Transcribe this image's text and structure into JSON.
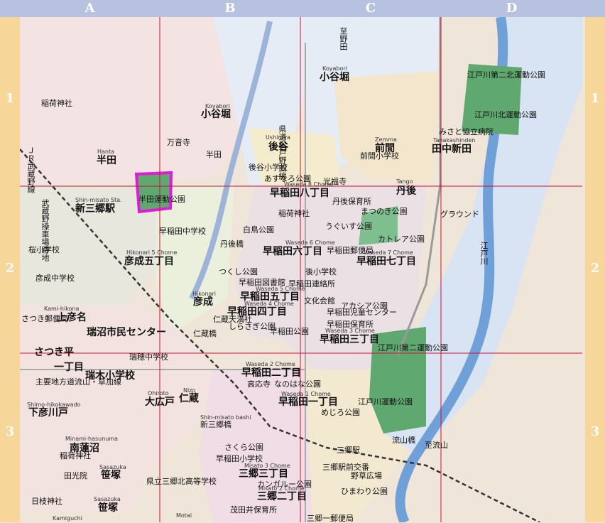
{
  "grid": {
    "columns": [
      "A",
      "B",
      "C",
      "D"
    ],
    "rows": [
      "1",
      "2",
      "3"
    ]
  },
  "colors": {
    "column_header": "#b7c2e1",
    "row_header": "#f7d69a",
    "grid_line": "#d0103a",
    "river": "#6fa0d8",
    "park": "#5fa870",
    "highlight": "#e01bd6",
    "railway": "#333333"
  },
  "labels": [
    {
      "name": "koyabori-north-en",
      "text": "Koyabori"
    },
    {
      "name": "koyabori-north",
      "text": "小谷堀"
    },
    {
      "name": "koyabori-west-en",
      "text": "Koyabori"
    },
    {
      "name": "koyabori-west",
      "text": "小谷堀"
    },
    {
      "name": "road-shinoda-v",
      "text": "至野田"
    },
    {
      "name": "inari-shrine",
      "text": "稲荷神社"
    },
    {
      "name": "manzoji",
      "text": "万音寺"
    },
    {
      "name": "handa-en",
      "text": "Hanta"
    },
    {
      "name": "handa",
      "text": "半田"
    },
    {
      "name": "handa-station",
      "text": "半田"
    },
    {
      "name": "ushiroya-en",
      "text": "Ushiroya"
    },
    {
      "name": "ushiroya",
      "text": "後谷"
    },
    {
      "name": "zenma-en",
      "text": "Zemma"
    },
    {
      "name": "zenma",
      "text": "前間"
    },
    {
      "name": "tanakashinden-en",
      "text": "Tanakashinden"
    },
    {
      "name": "tanakashinden",
      "text": "田中新田"
    },
    {
      "name": "misato-kyoritsu-hospital",
      "text": "みさと協立病院"
    },
    {
      "name": "edogawa-park-2n",
      "text": "江戸川第二北運動公園"
    },
    {
      "name": "edogawa-north-park",
      "text": "江戸川北運動公園"
    },
    {
      "name": "zenma-elementary",
      "text": "前間小学校"
    },
    {
      "name": "ushiroya-elementary",
      "text": "後谷小学校"
    },
    {
      "name": "azunaro-park",
      "text": "あすなろ公園"
    },
    {
      "name": "kojoin",
      "text": "光福寺"
    },
    {
      "name": "tango-en",
      "text": "Tango"
    },
    {
      "name": "tango",
      "text": "丹後"
    },
    {
      "name": "waseda8-en",
      "text": "Waseda 8 Chome"
    },
    {
      "name": "waseda8",
      "text": "早稲田八丁目"
    },
    {
      "name": "prefectural-road",
      "text": "県道松戸野田線"
    },
    {
      "name": "musashino-line",
      "text": "ＪＲ武蔵野線"
    },
    {
      "name": "musashino-v",
      "text": "武蔵野操車場跡地"
    },
    {
      "name": "shin-misato-en",
      "text": "Shin-misato Sta."
    },
    {
      "name": "shin-misato",
      "text": "新三郷駅"
    },
    {
      "name": "handa-park",
      "text": "半田運動公園"
    },
    {
      "name": "waseda-junior-high",
      "text": "早稲田中学校"
    },
    {
      "name": "shiratori-park",
      "text": "白鳥公園"
    },
    {
      "name": "tango-hospital",
      "text": "丹後保育所"
    },
    {
      "name": "matsunoki-park",
      "text": "まつのき公園"
    },
    {
      "name": "uguisu-park",
      "text": "うぐいす公園"
    },
    {
      "name": "ground",
      "text": "グラウンド"
    },
    {
      "name": "inari-shrine-2",
      "text": "稲荷神社"
    },
    {
      "name": "waseda6-en",
      "text": "Waseda 6 Chome"
    },
    {
      "name": "waseda6",
      "text": "早稲田六丁目"
    },
    {
      "name": "tango-bashi",
      "text": "丹後橋"
    },
    {
      "name": "kotoria-park",
      "text": "カトレア公園"
    },
    {
      "name": "waseda7-en",
      "text": "Waseda 7 Chome"
    },
    {
      "name": "waseda7",
      "text": "早稲田七丁目"
    },
    {
      "name": "waseda-post",
      "text": "早稲田郵便局"
    },
    {
      "name": "sakura-elementary",
      "text": "桜小学校"
    },
    {
      "name": "hikonari5-en",
      "text": "Hikonari 5 Chome"
    },
    {
      "name": "hikonari5",
      "text": "彦成五丁目"
    },
    {
      "name": "hikonari-junior-high",
      "text": "彦成中学校"
    },
    {
      "name": "tsukushi-park",
      "text": "つくし公園"
    },
    {
      "name": "ushiro-elementary",
      "text": "後小学校"
    },
    {
      "name": "waseda-library",
      "text": "早稲田図書館"
    },
    {
      "name": "waseda-office",
      "text": "早稲田連絡所"
    },
    {
      "name": "waseda5-en",
      "text": "Waseda 5 Chome"
    },
    {
      "name": "waseda5",
      "text": "早稲田五丁目"
    },
    {
      "name": "bunka-kaikan",
      "text": "文化会館"
    },
    {
      "name": "acacia-park",
      "text": "アカシア公園"
    },
    {
      "name": "kids-center",
      "text": "早稲田児童センター"
    },
    {
      "name": "hikonari-en",
      "text": "Hikonari"
    },
    {
      "name": "hikonari",
      "text": "彦成"
    },
    {
      "name": "kamihikona-en",
      "text": "Kami-hikona"
    },
    {
      "name": "kamihikona",
      "text": "上彦名"
    },
    {
      "name": "satsuki-post",
      "text": "さつき郵便局"
    },
    {
      "name": "waseda4-en",
      "text": "Waseda 4 Chome"
    },
    {
      "name": "waseda4",
      "text": "早稲田四丁目"
    },
    {
      "name": "nikotenjin",
      "text": "仁蔵天満社"
    },
    {
      "name": "waseda-nursery",
      "text": "早稲田保育所"
    },
    {
      "name": "shirasagi-park",
      "text": "しらさぎ公園"
    },
    {
      "name": "waseda-park",
      "text": "早稲田公園"
    },
    {
      "name": "mizunuma-center",
      "text": "瑞沼市民センター"
    },
    {
      "name": "waseda3-en",
      "text": "Waseda 3 Chome"
    },
    {
      "name": "waseda3",
      "text": "早稲田三丁目"
    },
    {
      "name": "satsuki-park",
      "text": "さつき平"
    },
    {
      "name": "satsukidaira-1",
      "text": "一丁目"
    },
    {
      "name": "mizuho-junior-high",
      "text": "瑞穂中学校"
    },
    {
      "name": "mizuho-elementary",
      "text": "瑞木小学校"
    },
    {
      "name": "nizo-en",
      "text": "Nizo"
    },
    {
      "name": "nizo",
      "text": "仁蔵"
    },
    {
      "name": "nizo-bashi",
      "text": "仁蔵橋"
    },
    {
      "name": "edogawa-park-2",
      "text": "江戸川第二運動公園"
    },
    {
      "name": "waseda2-en",
      "text": "Waseda 2 Chome"
    },
    {
      "name": "waseda2",
      "text": "早稲田二丁目"
    },
    {
      "name": "koryoji",
      "text": "高応寺"
    },
    {
      "name": "nanohana-park",
      "text": "なのはな公園"
    },
    {
      "name": "ohiroto-en",
      "text": "Ohiroto"
    },
    {
      "name": "ohiroto",
      "text": "大広戸"
    },
    {
      "name": "waseda1-en",
      "text": "Waseda 1 Chome"
    },
    {
      "name": "waseda1",
      "text": "早稲田一丁目"
    },
    {
      "name": "edogawa-park",
      "text": "江戸川運動公園"
    },
    {
      "name": "mejiro-park",
      "text": "めじろ公園"
    },
    {
      "name": "main-road",
      "text": "主要地方道流山・草加線"
    },
    {
      "name": "shimohikokawado-en",
      "text": "Shimo-hikokawado"
    },
    {
      "name": "shimohikokawado",
      "text": "下彦川戸"
    },
    {
      "name": "shin-misato-bashi-en",
      "text": "Shin-misato bashi"
    },
    {
      "name": "shin-misato-bashi",
      "text": "新三郷橋"
    },
    {
      "name": "minami-hasunuma-en",
      "text": "Minami-hasunuma"
    },
    {
      "name": "minami-hasunuma",
      "text": "南蓮沼"
    },
    {
      "name": "inari-shrine-3",
      "text": "稲荷神社"
    },
    {
      "name": "sakura-park",
      "text": "さくら公園"
    },
    {
      "name": "nagareyama-bashi",
      "text": "流山橋"
    },
    {
      "name": "to-nagareyama",
      "text": "至流山"
    },
    {
      "name": "misato-station",
      "text": "三郷駅"
    },
    {
      "name": "sasazuka-en",
      "text": "Sasazuka"
    },
    {
      "name": "sasazuka",
      "text": "笹塚"
    },
    {
      "name": "misato-east-high",
      "text": "県立三郷北高等学校"
    },
    {
      "name": "denkoin",
      "text": "田光院"
    },
    {
      "name": "waseda-elementary",
      "text": "早稲田小学校"
    },
    {
      "name": "misato3-en",
      "text": "Misato 3 Chome"
    },
    {
      "name": "misato3",
      "text": "三郷三丁目"
    },
    {
      "name": "kangaroo-park",
      "text": "カンガルー公園"
    },
    {
      "name": "misato-gate",
      "text": "三郷駅前交番"
    },
    {
      "name": "nokusa-hiroba",
      "text": "野草広場"
    },
    {
      "name": "misato2-en",
      "text": "Misato 2 Chome"
    },
    {
      "name": "misato2",
      "text": "三郷二丁目"
    },
    {
      "name": "himawari-park",
      "text": "ひまわり公園"
    },
    {
      "name": "sasazuka2-en",
      "text": "Sasazuka"
    },
    {
      "name": "sasazuka2",
      "text": "笹塚"
    },
    {
      "name": "hiyoshi-shrine",
      "text": "日枝神社"
    },
    {
      "name": "motai-en",
      "text": "Motai"
    },
    {
      "name": "kamiguchi-en",
      "text": "Kamiguchi"
    },
    {
      "name": "mosaibashi-nursery",
      "text": "茂田井保育所"
    },
    {
      "name": "misato1-post",
      "text": "三郷一郵便局"
    },
    {
      "name": "edo-river-v",
      "text": "江戸川"
    }
  ]
}
